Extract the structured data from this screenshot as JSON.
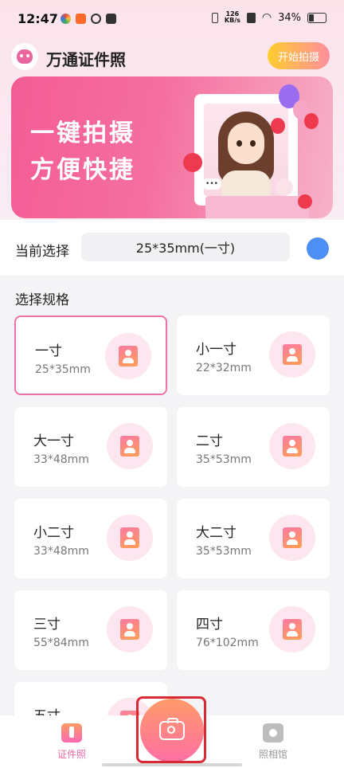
{
  "status_bar": {
    "time": "12:47",
    "net_speed_top": "126",
    "net_speed_bottom": "KB/s",
    "battery": "34%"
  },
  "header": {
    "title": "万通证件照",
    "start_button": "开始拍摄"
  },
  "banner": {
    "line1": "一键拍摄",
    "line2": "方便快捷"
  },
  "current": {
    "label": "当前选择",
    "value": "25*35mm(一寸)"
  },
  "specs": {
    "title": "选择规格",
    "items": [
      {
        "name": "一寸",
        "size": "25*35mm"
      },
      {
        "name": "小一寸",
        "size": "22*32mm"
      },
      {
        "name": "大一寸",
        "size": "33*48mm"
      },
      {
        "name": "二寸",
        "size": "35*53mm"
      },
      {
        "name": "小二寸",
        "size": "33*48mm"
      },
      {
        "name": "大二寸",
        "size": "35*53mm"
      },
      {
        "name": "三寸",
        "size": "55*84mm"
      },
      {
        "name": "四寸",
        "size": "76*102mm"
      },
      {
        "name": "五寸",
        "size": ""
      }
    ]
  },
  "tabs": {
    "id_photo": "证件照",
    "gallery": "照相馆"
  },
  "colors": {
    "accent": "#f070a8",
    "blue_dot": "#4e8ff5",
    "highlight_outline": "#d82935"
  }
}
